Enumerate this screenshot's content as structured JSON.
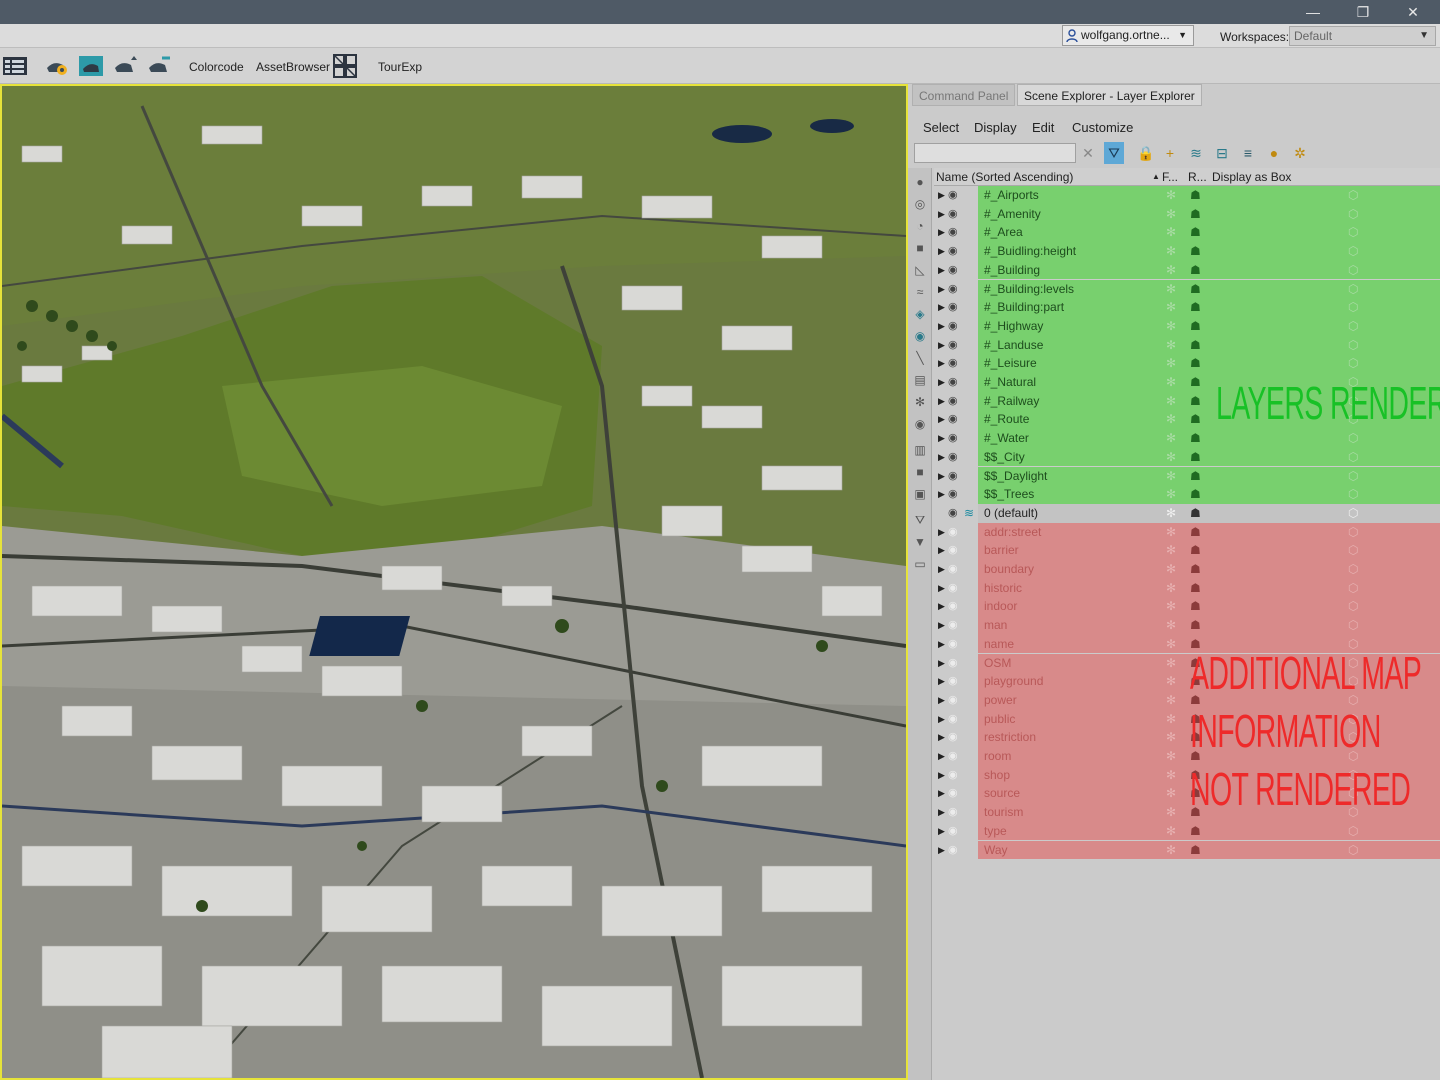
{
  "window": {
    "minimize_glyph": "—",
    "restore_glyph": "❐",
    "close_glyph": "✕"
  },
  "userbar": {
    "user": "wolfgang.ortne...",
    "workspaces_label": "Workspaces:",
    "workspace_value": "Default"
  },
  "toolbar": {
    "colorcode": "Colorcode",
    "assetbrowser": "AssetBrowser",
    "tourexp": "TourExp"
  },
  "panel": {
    "tabs": [
      "Command Panel",
      "Scene Explorer - Layer Explorer"
    ],
    "menu": [
      "Select",
      "Display",
      "Edit",
      "Customize"
    ],
    "columns": {
      "name": "Name (Sorted Ascending)",
      "sort_glyph": "▲",
      "frozen": "F...",
      "renderable": "R...",
      "display_as_box": "Display as Box"
    },
    "layers": [
      {
        "name": "#_Airports",
        "group": "rendered"
      },
      {
        "name": "#_Amenity",
        "group": "rendered"
      },
      {
        "name": "#_Area",
        "group": "rendered"
      },
      {
        "name": "#_Buidling:height",
        "group": "rendered"
      },
      {
        "name": "#_Building",
        "group": "rendered"
      },
      {
        "name": "#_Building:levels",
        "group": "rendered"
      },
      {
        "name": "#_Building:part",
        "group": "rendered"
      },
      {
        "name": "#_Highway",
        "group": "rendered"
      },
      {
        "name": "#_Landuse",
        "group": "rendered"
      },
      {
        "name": "#_Leisure",
        "group": "rendered"
      },
      {
        "name": "#_Natural",
        "group": "rendered"
      },
      {
        "name": "#_Railway",
        "group": "rendered"
      },
      {
        "name": "#_Route",
        "group": "rendered"
      },
      {
        "name": "#_Water",
        "group": "rendered"
      },
      {
        "name": "$$_City",
        "group": "rendered"
      },
      {
        "name": "$$_Daylight",
        "group": "rendered"
      },
      {
        "name": "$$_Trees",
        "group": "rendered"
      },
      {
        "name": "0 (default)",
        "group": "default"
      },
      {
        "name": "addr:street",
        "group": "hidden"
      },
      {
        "name": "barrier",
        "group": "hidden"
      },
      {
        "name": "boundary",
        "group": "hidden"
      },
      {
        "name": "historic",
        "group": "hidden"
      },
      {
        "name": "indoor",
        "group": "hidden"
      },
      {
        "name": "man",
        "group": "hidden"
      },
      {
        "name": "name",
        "group": "hidden"
      },
      {
        "name": "OSM",
        "group": "hidden"
      },
      {
        "name": "playground",
        "group": "hidden"
      },
      {
        "name": "power",
        "group": "hidden"
      },
      {
        "name": "public",
        "group": "hidden"
      },
      {
        "name": "restriction",
        "group": "hidden"
      },
      {
        "name": "room",
        "group": "hidden"
      },
      {
        "name": "shop",
        "group": "hidden"
      },
      {
        "name": "source",
        "group": "hidden"
      },
      {
        "name": "tourism",
        "group": "hidden"
      },
      {
        "name": "type",
        "group": "hidden"
      },
      {
        "name": "Way",
        "group": "hidden"
      }
    ],
    "annotations": {
      "rendered": "LAYERS RENDERED",
      "not_rendered_lines": [
        "ADDITIONAL MAP",
        "INFORMATION",
        "NOT RENDERED"
      ]
    },
    "colors": {
      "rendered_band": "#78d06e",
      "default_band": "#c3c3c3",
      "hidden_band": "#d88a8a",
      "rendered_text": "#18c126",
      "not_rendered_text": "#ee2a2a",
      "viewport_border": "#e6e33a"
    }
  }
}
